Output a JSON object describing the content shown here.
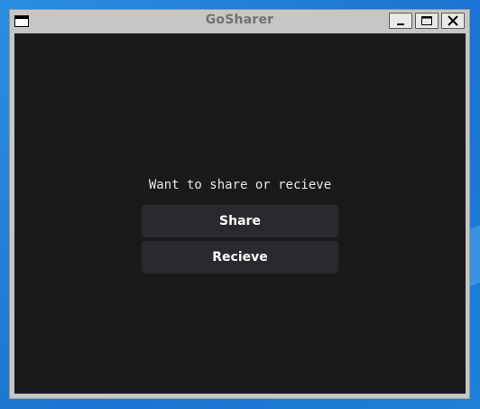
{
  "window": {
    "title": "GoSharer"
  },
  "main": {
    "prompt": "Want to share or recieve",
    "share_label": "Share",
    "recieve_label": "Recieve"
  },
  "colors": {
    "desktop": "#1a73d0",
    "window_frame": "#c6c6c6",
    "client_background": "#1a1a1a",
    "button_background": "#2a2a2e",
    "button_text": "#ffffff"
  },
  "icons": {
    "system_menu": "window-menu-icon",
    "minimize": "minimize-icon",
    "maximize": "maximize-icon",
    "close": "close-icon"
  }
}
